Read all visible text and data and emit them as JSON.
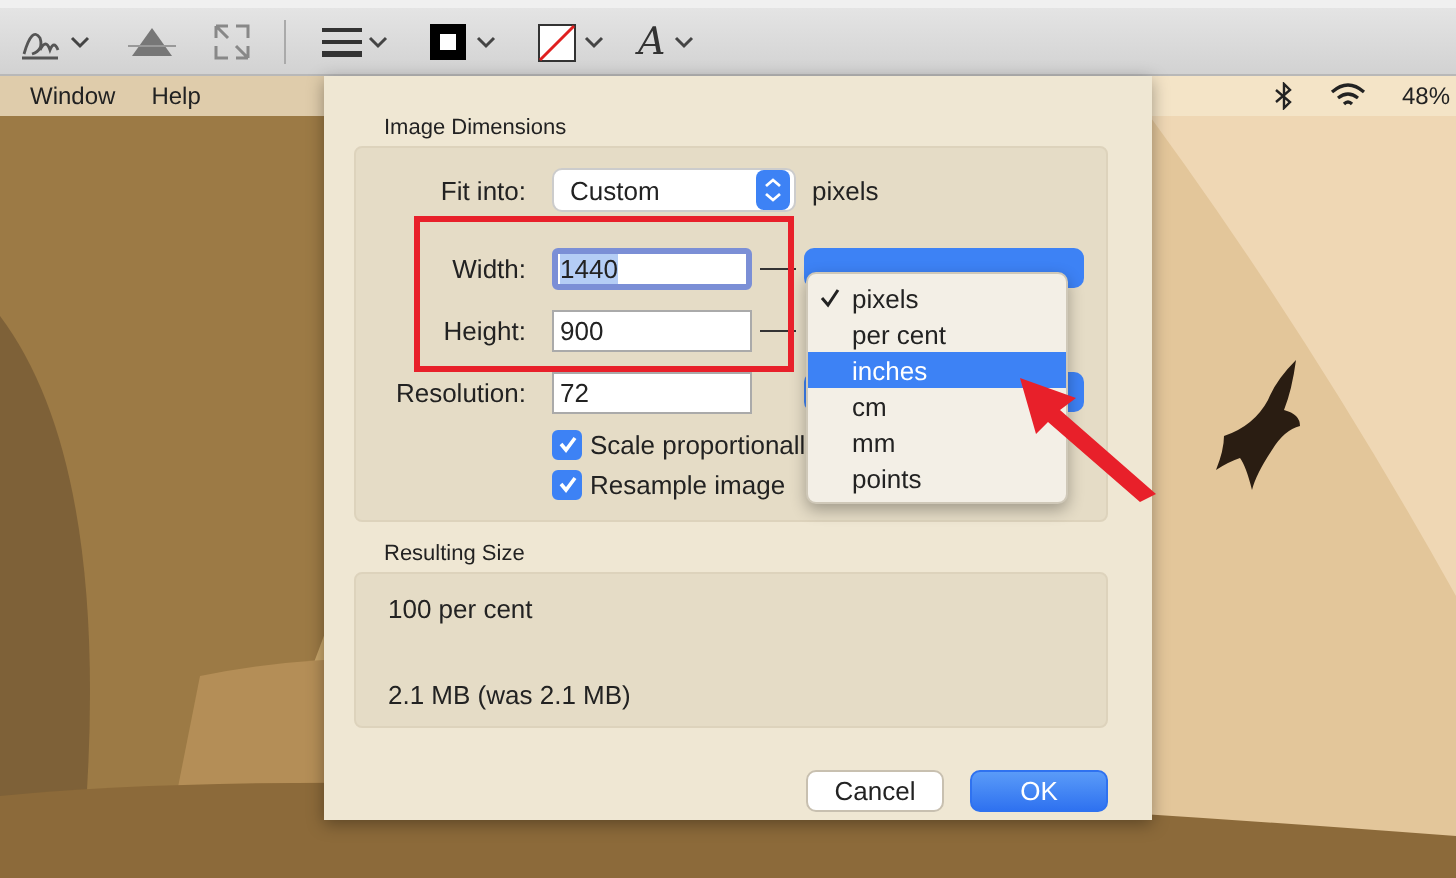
{
  "toolbar": {
    "text_style_glyph": "A"
  },
  "menu_bar": {
    "items": [
      "Window",
      "Help"
    ],
    "battery": "48%"
  },
  "dialog": {
    "dimensions_section": {
      "title": "Image Dimensions",
      "fit_into": {
        "label": "Fit into:",
        "value": "Custom",
        "unit": "pixels"
      },
      "fields": [
        {
          "label": "Width:",
          "value": "1440",
          "focused": true
        },
        {
          "label": "Height:",
          "value": "900",
          "focused": false
        },
        {
          "label": "Resolution:",
          "value": "72",
          "focused": false
        }
      ],
      "checkboxes": [
        {
          "label": "Scale proportionall",
          "checked": true
        },
        {
          "label": "Resample image",
          "checked": true
        }
      ]
    },
    "result_section": {
      "title": "Resulting Size",
      "lines": [
        "100 per cent",
        "2.1 MB (was 2.1 MB)"
      ]
    },
    "buttons": [
      {
        "label": "Cancel",
        "kind": "secondary"
      },
      {
        "label": "OK",
        "kind": "primary"
      }
    ]
  },
  "unit_menu": {
    "items": [
      {
        "label": "pixels",
        "checked": true,
        "selected": false
      },
      {
        "label": "per cent",
        "checked": false,
        "selected": false
      },
      {
        "label": "inches",
        "checked": false,
        "selected": true
      },
      {
        "label": "cm",
        "checked": false,
        "selected": false
      },
      {
        "label": "mm",
        "checked": false,
        "selected": false
      },
      {
        "label": "points",
        "checked": false,
        "selected": false
      }
    ]
  }
}
